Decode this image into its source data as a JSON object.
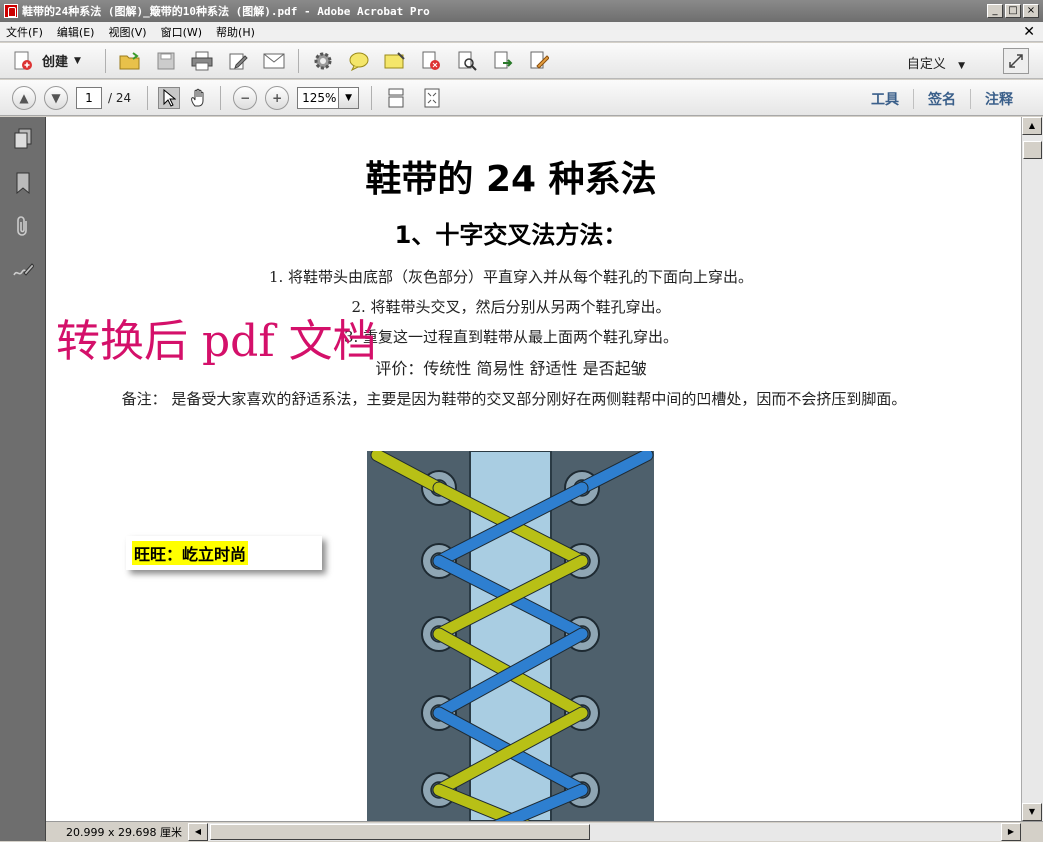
{
  "window": {
    "title": "鞋带的24种系法 (图解)_簸带的10种系法 (图解).pdf - Adobe Acrobat Pro",
    "minimize": "_",
    "maximize": "□",
    "close": "×"
  },
  "menu": [
    "文件(F)",
    "编辑(E)",
    "视图(V)",
    "窗口(W)",
    "帮助(H)"
  ],
  "toolbar": {
    "create_label": "创建",
    "custom_label": "自定义",
    "icons": [
      "open-icon",
      "save-icon",
      "print-icon",
      "edit-icon",
      "email-icon",
      "settings-icon",
      "comment-icon",
      "highlight-icon",
      "delete-page-icon",
      "search-icon",
      "export-icon",
      "sign-icon"
    ]
  },
  "nav": {
    "page_current": "1",
    "page_total": "/ 24",
    "zoom": "125%",
    "tabs": [
      "工具",
      "签名",
      "注释"
    ]
  },
  "document": {
    "title": "鞋带的 24 种系法",
    "section": "1、十字交叉法方法：",
    "steps": [
      "1. 将鞋带头由底部（灰色部分）平直穿入并从每个鞋孔的下面向上穿出。",
      "2. 将鞋带头交叉，然后分别从另两个鞋孔穿出。",
      "3. 重复这一过程直到鞋带从最上面两个鞋孔穿出。"
    ],
    "evaluation": "评价：传统性  简易性  舒适性  是否起皱",
    "note": "备注：  是备受大家喜欢的舒适系法，主要是因为鞋带的交叉部分刚好在两侧鞋帮中间的凹槽处，因而不会挤压到脚面。",
    "watermark": "转换后 pdf 文档",
    "sticky": "旺旺：屹立时尚"
  },
  "status": {
    "page_size": "20.999 x 29.698 厘米"
  },
  "colors": {
    "watermark": "#d4106a",
    "lace_blue": "#2e7fd0",
    "lace_yellow": "#b8c016",
    "shoe_gray": "#4e606c",
    "tongue": "#a9cde2"
  }
}
